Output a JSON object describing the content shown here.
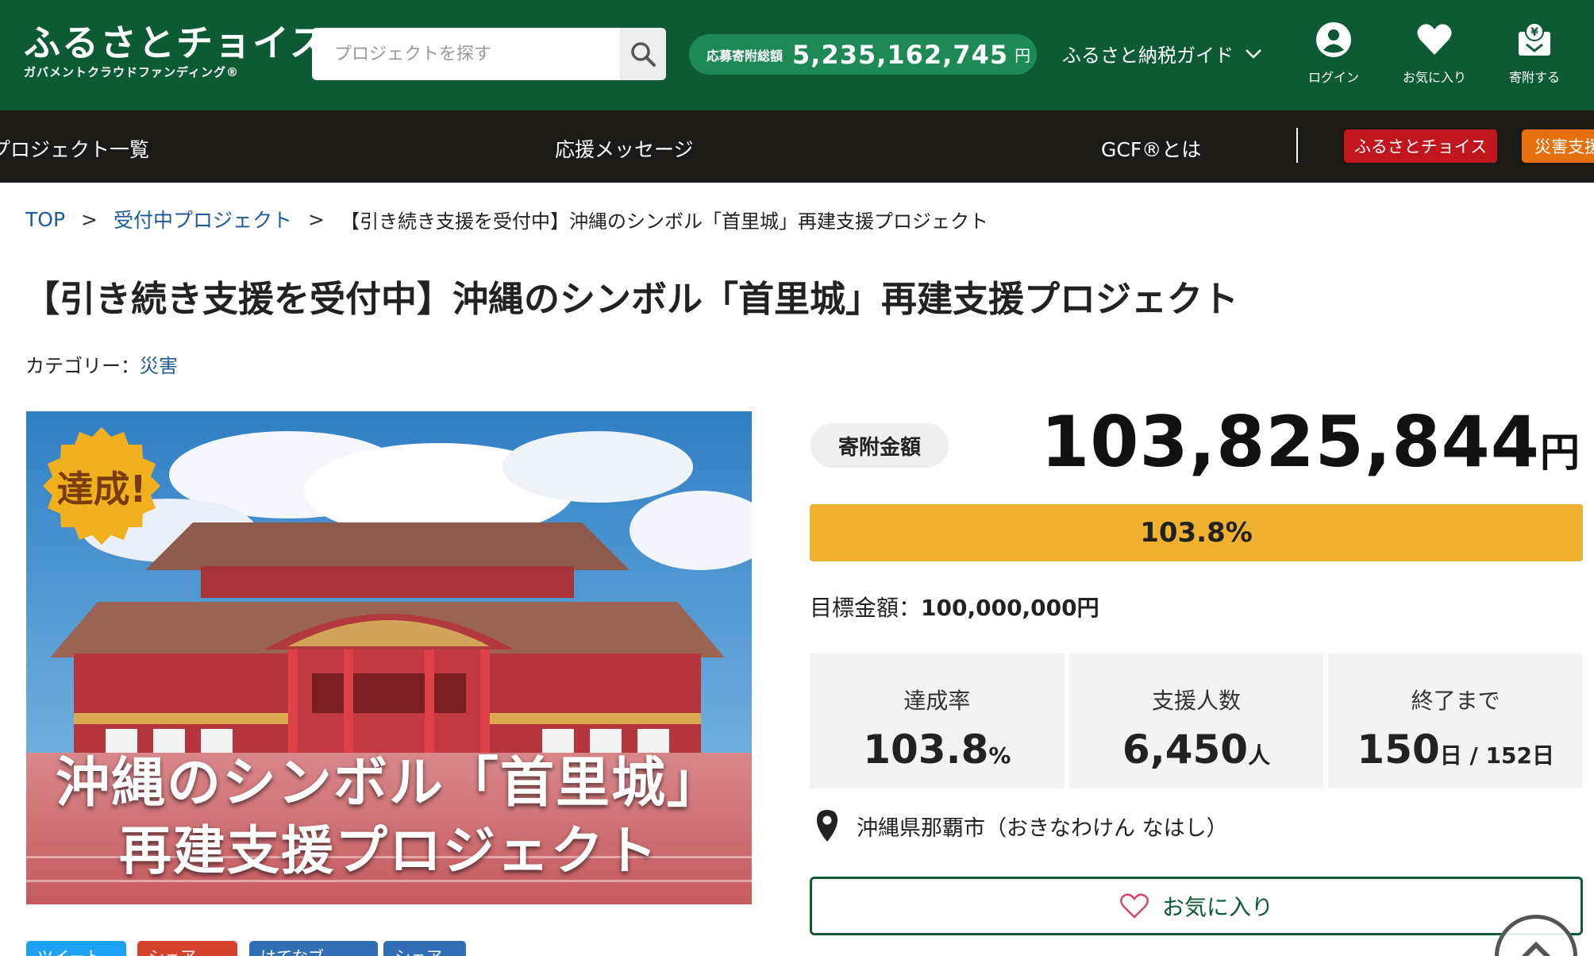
{
  "header": {
    "logo_main": "ふるさとチョイス",
    "logo_sub": "ガバメントクラウドファンディング®",
    "search_placeholder": "プロジェクトを探す",
    "total_label": "応募寄附総額",
    "total_value": "5,235,162,745",
    "total_unit": "円",
    "guide_label": "ふるさと納税ガイド",
    "icons": [
      {
        "name": "user-icon",
        "label": "ログイン"
      },
      {
        "name": "heart-icon",
        "label": "お気に入り"
      },
      {
        "name": "donate-icon",
        "label": "寄附する"
      }
    ]
  },
  "nav": {
    "items": [
      "プロジェクト一覧",
      "応援メッセージ",
      "GCF®とは"
    ],
    "badge_red": "ふるさとチョイス",
    "badge_orange": "災害支援"
  },
  "breadcrumb": {
    "top": "TOP",
    "sep": ">",
    "parent": "受付中プロジェクト",
    "current": "【引き続き支援を受付中】沖縄のシンボル「首里城」再建支援プロジェクト"
  },
  "page": {
    "title": "【引き続き支援を受付中】沖縄のシンボル「首里城」再建支援プロジェクト",
    "category_label": "カテゴリー：",
    "category_value": "災害"
  },
  "hero": {
    "badge": "達成!",
    "line1": "沖縄のシンボル「首里城」",
    "line2": "再建支援プロジェクト"
  },
  "social": [
    "ツイート",
    "シェア",
    "はてなブ",
    "シェア"
  ],
  "funding": {
    "amount_label": "寄附金額",
    "amount_value": "103,825,844",
    "amount_unit": "円",
    "progress_text": "103.8%",
    "progress_fraction": 1.0,
    "goal_label": "目標金額：",
    "goal_value": "100,000,000円",
    "stats": [
      {
        "label": "達成率",
        "value": "103.8",
        "unit": "%"
      },
      {
        "label": "支援人数",
        "value": "6,450",
        "unit": "人"
      },
      {
        "label": "終了まで",
        "value": "150",
        "unit": "日 / 152日"
      }
    ],
    "location": "沖縄県那覇市（おきなわけん なはし）",
    "favorite_label": "お気に入り"
  },
  "colors": {
    "header_green": "#0c5b34",
    "pill_green": "#1d8a56",
    "nav_dark": "#1c1a14",
    "progress_yellow": "#f0b030",
    "link_blue": "#1e5a9e",
    "badge_red": "#c2161e",
    "badge_orange": "#e6700d"
  }
}
